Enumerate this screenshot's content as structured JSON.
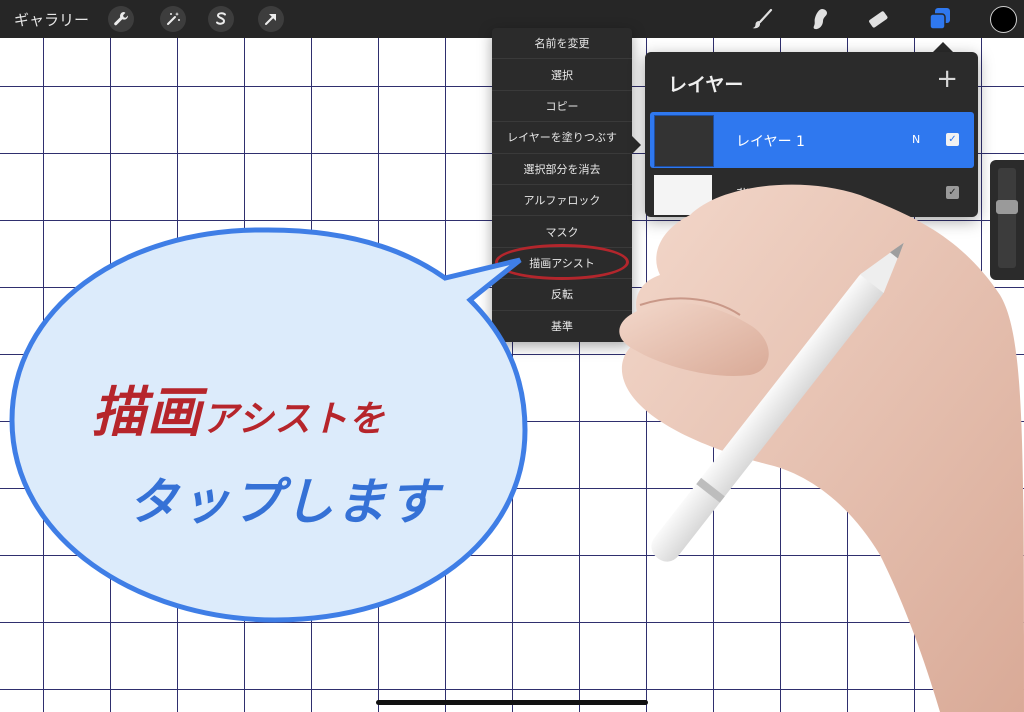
{
  "topbar": {
    "gallery_label": "ギャラリー",
    "tools_left": [
      "wrench-icon",
      "magic-wand-icon",
      "selection-icon",
      "arrow-icon"
    ],
    "tools_right": [
      "brush-icon",
      "smudge-icon",
      "eraser-icon",
      "layers-icon"
    ],
    "active_tool": "layers-icon",
    "active_color": "#000000",
    "accent": "#2f78ef"
  },
  "layer_menu": {
    "items": [
      "名前を変更",
      "選択",
      "コピー",
      "レイヤーを塗りつぶす",
      "選択部分を消去",
      "アルファロック",
      "マスク",
      "描画アシスト",
      "反転",
      "基準"
    ],
    "highlighted": "描画アシスト"
  },
  "layers_panel": {
    "title": "レイヤー",
    "add_label": "+",
    "layers": [
      {
        "name": "レイヤー 1",
        "mode": "N",
        "visible": true,
        "selected": true
      },
      {
        "name": "背景色",
        "visible": true,
        "selected": false
      }
    ]
  },
  "callout": {
    "line1_big": "描画",
    "line1_small": "アシストを",
    "line2": "タップします",
    "line1_color": "#b6252b",
    "line2_color": "#3571d6",
    "fill": "#dcebfb",
    "stroke": "#3f7ee6"
  }
}
